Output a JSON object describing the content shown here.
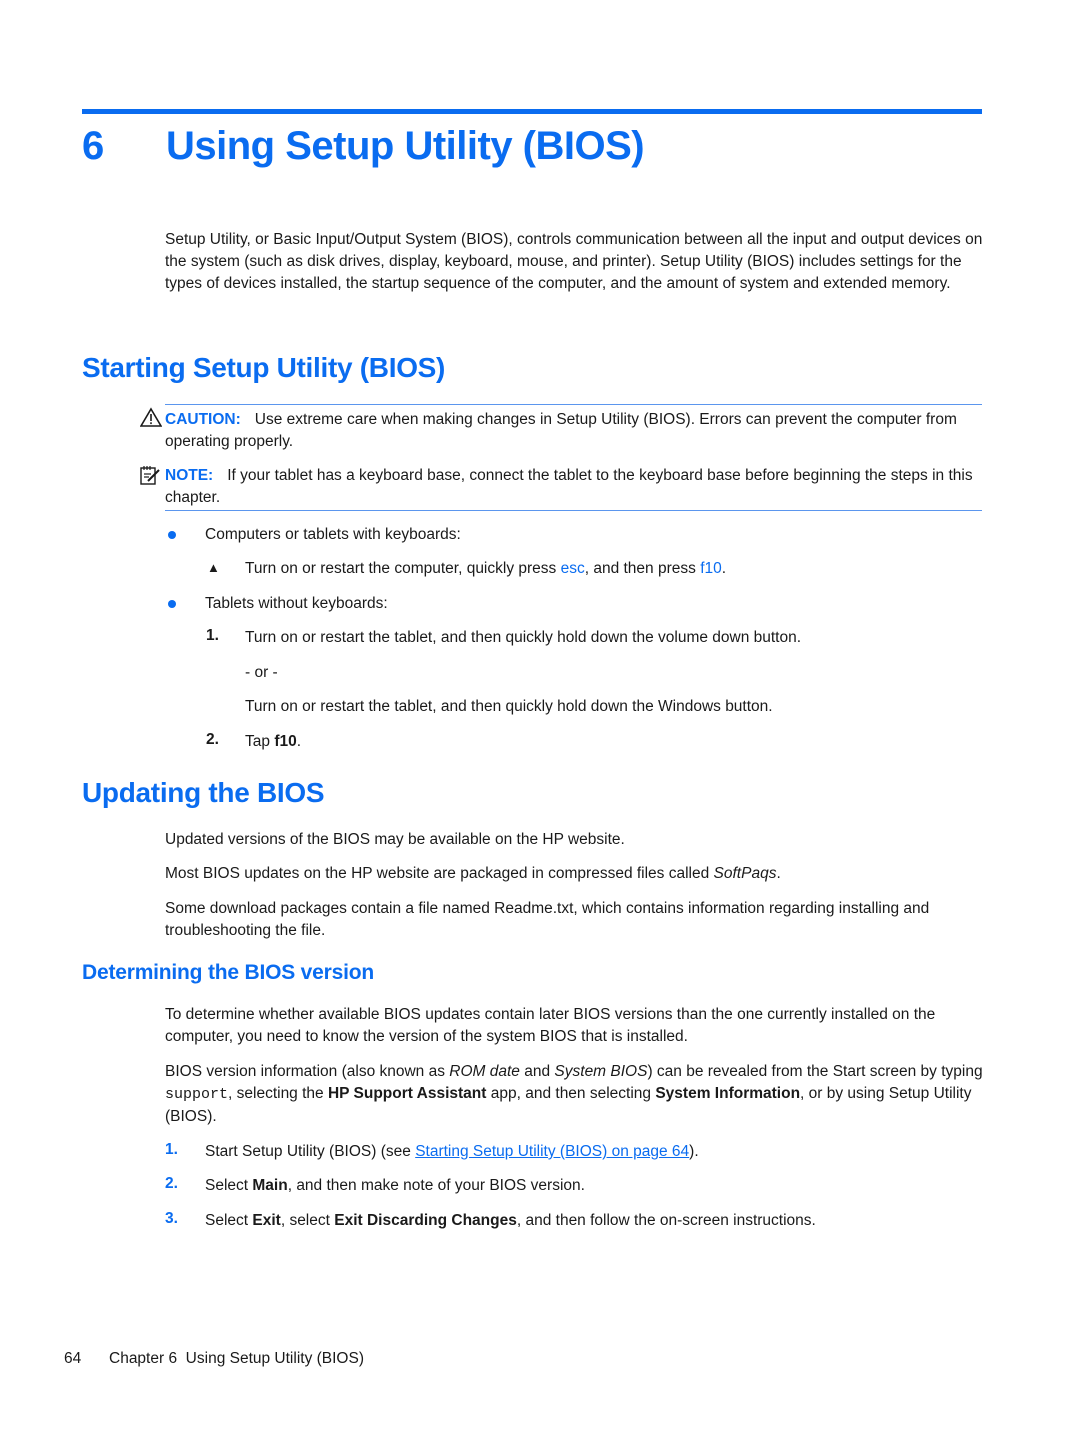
{
  "chapter": {
    "number": "6",
    "title": "Using Setup Utility (BIOS)"
  },
  "intro": "Setup Utility, or Basic Input/Output System (BIOS), controls communication between all the input and output devices on the system (such as disk drives, display, keyboard, mouse, and printer). Setup Utility (BIOS) includes settings for the types of devices installed, the startup sequence of the computer, and the amount of system and extended memory.",
  "starting": {
    "heading": "Starting Setup Utility (BIOS)",
    "caution": {
      "icon": "warning-triangle-icon",
      "label": "CAUTION:",
      "text": "Use extreme care when making changes in Setup Utility (BIOS). Errors can prevent the computer from operating properly."
    },
    "note": {
      "icon": "note-pencil-icon",
      "label": "NOTE:",
      "text": "If your tablet has a keyboard base, connect the tablet to the keyboard base before beginning the steps in this chapter."
    },
    "bullets": [
      {
        "text": "Computers or tablets with keyboards:",
        "step": {
          "marker": "▲",
          "pre": "Turn on or restart the computer, quickly press ",
          "key1": "esc",
          "mid": ", and then press ",
          "key2": "f10",
          "post": "."
        }
      },
      {
        "text": "Tablets without keyboards:",
        "steps": [
          {
            "num": "1.",
            "text": "Turn on or restart the tablet, and then quickly hold down the volume down button."
          },
          {
            "or": "- or -"
          },
          {
            "text": "Turn on or restart the tablet, and then quickly hold down the Windows button."
          },
          {
            "num": "2.",
            "pre": "Tap ",
            "bold": "f10",
            "post": "."
          }
        ]
      }
    ]
  },
  "updating": {
    "heading": "Updating the BIOS",
    "paragraphs": [
      "Updated versions of the BIOS may be available on the HP website.",
      {
        "pre": "Most BIOS updates on the HP website are packaged in compressed files called ",
        "italic": "SoftPaqs",
        "post": "."
      },
      "Some download packages contain a file named Readme.txt, which contains information regarding installing and troubleshooting the file."
    ]
  },
  "determining": {
    "heading": "Determining the BIOS version",
    "p1": "To determine whether available BIOS updates contain later BIOS versions than the one currently installed on the computer, you need to know the version of the system BIOS that is installed.",
    "p2": {
      "a": "BIOS version information (also known as ",
      "i1": "ROM date",
      "b": " and ",
      "i2": "System BIOS",
      "c": ") can be revealed from the Start screen by typing ",
      "code": "support",
      "d": ", selecting the ",
      "b1": "HP Support Assistant",
      "e": " app, and then selecting ",
      "b2": "System Information",
      "f": ", or by using Setup Utility (BIOS)."
    },
    "steps": [
      {
        "num": "1.",
        "pre": "Start Setup Utility (BIOS) (see ",
        "link": "Starting Setup Utility (BIOS) on page 64",
        "post": ")."
      },
      {
        "num": "2.",
        "pre": "Select ",
        "bold": "Main",
        "post": ", and then make note of your BIOS version."
      },
      {
        "num": "3.",
        "pre": "Select ",
        "bold": "Exit",
        "mid": ", select ",
        "bold2": "Exit Discarding Changes",
        "post": ", and then follow the on-screen instructions."
      }
    ]
  },
  "footer": {
    "page": "64",
    "text": "Chapter 6  Using Setup Utility (BIOS)"
  }
}
